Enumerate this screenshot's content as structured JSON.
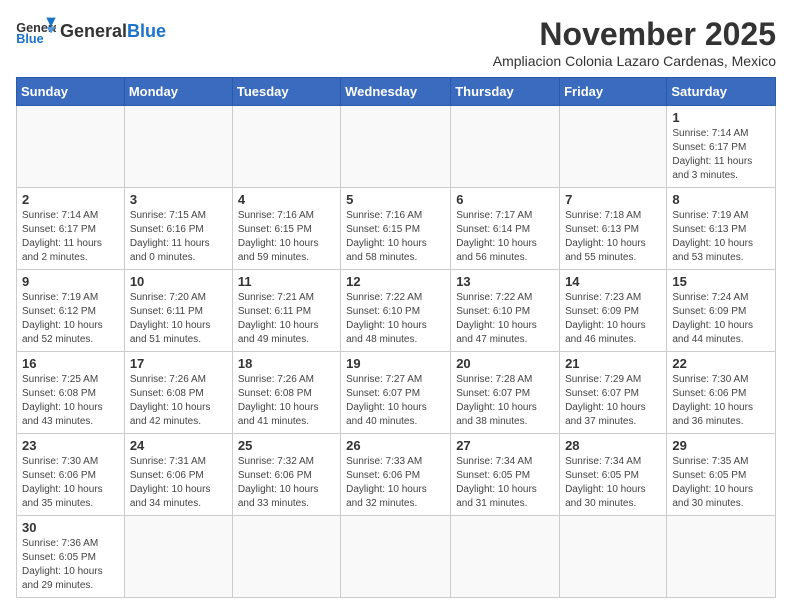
{
  "header": {
    "logo_general": "General",
    "logo_blue": "Blue",
    "month_title": "November 2025",
    "subtitle": "Ampliacion Colonia Lazaro Cardenas, Mexico"
  },
  "weekdays": [
    "Sunday",
    "Monday",
    "Tuesday",
    "Wednesday",
    "Thursday",
    "Friday",
    "Saturday"
  ],
  "days": {
    "1": {
      "sunrise": "7:14 AM",
      "sunset": "6:17 PM",
      "daylight": "11 hours and 3 minutes."
    },
    "2": {
      "sunrise": "7:14 AM",
      "sunset": "6:17 PM",
      "daylight": "11 hours and 2 minutes."
    },
    "3": {
      "sunrise": "7:15 AM",
      "sunset": "6:16 PM",
      "daylight": "11 hours and 0 minutes."
    },
    "4": {
      "sunrise": "7:16 AM",
      "sunset": "6:15 PM",
      "daylight": "10 hours and 59 minutes."
    },
    "5": {
      "sunrise": "7:16 AM",
      "sunset": "6:15 PM",
      "daylight": "10 hours and 58 minutes."
    },
    "6": {
      "sunrise": "7:17 AM",
      "sunset": "6:14 PM",
      "daylight": "10 hours and 56 minutes."
    },
    "7": {
      "sunrise": "7:18 AM",
      "sunset": "6:13 PM",
      "daylight": "10 hours and 55 minutes."
    },
    "8": {
      "sunrise": "7:19 AM",
      "sunset": "6:13 PM",
      "daylight": "10 hours and 53 minutes."
    },
    "9": {
      "sunrise": "7:19 AM",
      "sunset": "6:12 PM",
      "daylight": "10 hours and 52 minutes."
    },
    "10": {
      "sunrise": "7:20 AM",
      "sunset": "6:11 PM",
      "daylight": "10 hours and 51 minutes."
    },
    "11": {
      "sunrise": "7:21 AM",
      "sunset": "6:11 PM",
      "daylight": "10 hours and 49 minutes."
    },
    "12": {
      "sunrise": "7:22 AM",
      "sunset": "6:10 PM",
      "daylight": "10 hours and 48 minutes."
    },
    "13": {
      "sunrise": "7:22 AM",
      "sunset": "6:10 PM",
      "daylight": "10 hours and 47 minutes."
    },
    "14": {
      "sunrise": "7:23 AM",
      "sunset": "6:09 PM",
      "daylight": "10 hours and 46 minutes."
    },
    "15": {
      "sunrise": "7:24 AM",
      "sunset": "6:09 PM",
      "daylight": "10 hours and 44 minutes."
    },
    "16": {
      "sunrise": "7:25 AM",
      "sunset": "6:08 PM",
      "daylight": "10 hours and 43 minutes."
    },
    "17": {
      "sunrise": "7:26 AM",
      "sunset": "6:08 PM",
      "daylight": "10 hours and 42 minutes."
    },
    "18": {
      "sunrise": "7:26 AM",
      "sunset": "6:08 PM",
      "daylight": "10 hours and 41 minutes."
    },
    "19": {
      "sunrise": "7:27 AM",
      "sunset": "6:07 PM",
      "daylight": "10 hours and 40 minutes."
    },
    "20": {
      "sunrise": "7:28 AM",
      "sunset": "6:07 PM",
      "daylight": "10 hours and 38 minutes."
    },
    "21": {
      "sunrise": "7:29 AM",
      "sunset": "6:07 PM",
      "daylight": "10 hours and 37 minutes."
    },
    "22": {
      "sunrise": "7:30 AM",
      "sunset": "6:06 PM",
      "daylight": "10 hours and 36 minutes."
    },
    "23": {
      "sunrise": "7:30 AM",
      "sunset": "6:06 PM",
      "daylight": "10 hours and 35 minutes."
    },
    "24": {
      "sunrise": "7:31 AM",
      "sunset": "6:06 PM",
      "daylight": "10 hours and 34 minutes."
    },
    "25": {
      "sunrise": "7:32 AM",
      "sunset": "6:06 PM",
      "daylight": "10 hours and 33 minutes."
    },
    "26": {
      "sunrise": "7:33 AM",
      "sunset": "6:06 PM",
      "daylight": "10 hours and 32 minutes."
    },
    "27": {
      "sunrise": "7:34 AM",
      "sunset": "6:05 PM",
      "daylight": "10 hours and 31 minutes."
    },
    "28": {
      "sunrise": "7:34 AM",
      "sunset": "6:05 PM",
      "daylight": "10 hours and 30 minutes."
    },
    "29": {
      "sunrise": "7:35 AM",
      "sunset": "6:05 PM",
      "daylight": "10 hours and 30 minutes."
    },
    "30": {
      "sunrise": "7:36 AM",
      "sunset": "6:05 PM",
      "daylight": "10 hours and 29 minutes."
    }
  },
  "labels": {
    "sunrise": "Sunrise:",
    "sunset": "Sunset:",
    "daylight": "Daylight:"
  }
}
